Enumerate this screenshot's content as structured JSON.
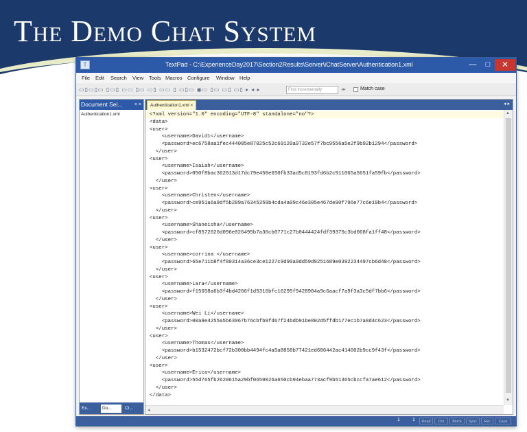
{
  "slide": {
    "title": "The Demo Chat System"
  },
  "window": {
    "title": "TextPad - C:\\ExperienceDay2017\\Section2Results\\Server\\iChatServer\\Authentication1.xml",
    "controls": {
      "minimize": "—",
      "maximize": "□",
      "close": "✕"
    }
  },
  "menu": [
    "File",
    "Edit",
    "Search",
    "View",
    "Tools",
    "Macros",
    "Configure",
    "Window",
    "Help"
  ],
  "toolbar": {
    "find_placeholder": "Find Incrementally",
    "match_case_label": "Match case"
  },
  "document_selector": {
    "title": "Document Sel...",
    "close": "× ×",
    "files": [
      "Authentication1.xml"
    ],
    "tabs": [
      "Ex...",
      "Do...",
      "Cl..."
    ]
  },
  "editor": {
    "tab_label": "Authentication1.xml ×",
    "tabstrip_controls": "◂ ▸",
    "lines": [
      "<?xml version=\"1.0\" encoding=\"UTF-8\" standalone=\"no\"?>",
      "<data>",
      "<user>",
      "    <username>David1</username>",
      "    <password>ec6758aa1fec444085e87025c52c69120a9732e57f7bc9556a5e2f9b92b1294</password>",
      "  </user>",
      "<user>",
      "    <username>Isaiah</username>",
      "    <password>050f8bac362013d17dc79e450e650fb33ad5c8193fd6b2c911065a5651fa59fb</password>",
      "  </user>",
      "<user>",
      "    <username>Christen</username>",
      "    <password>ce951a6a9df5b289a76345359b4cda4a09c46e305e467de90f796e77c6e19b4</password>",
      "  </user>",
      "<user>",
      "    <username>Shaneisha</username>",
      "    <password>cf8572026d096e026495b7a36cb0771c27b0444424fdf39375c3bd068fa1ff48</password>",
      "  </user>",
      "<user>",
      "    <username>corrina </username>",
      "    <password>65e711b8f4f80314a36ce3ce1227c9d90a9dd59d9251689e0392234497cb6d48</password>",
      "  </user>",
      "<user>",
      "    <username>Lara</username>",
      "    <password>f15658a6b3f4bd4266f1d5316bfc16295f9428904a9c6aacf7a9f3a3c5df7bb6</password>",
      "  </user>",
      "<user>",
      "    <username>Wei Li</username>",
      "    <password>00a9e4255a5b63067b76cbfb9fd67f24bdb91be802d5ffdb177ec1b7a8d4c623</password>",
      "  </user>",
      "<user>",
      "    <username>Thomas</username>",
      "    <password>b1532472bcf72b300bb4494fc4a5a8858b77421ed606442ac414002b9cc9f43f</password>",
      "  </user>",
      "<user>",
      "    <username>Erica</username>",
      "    <password>55d765fb2620615a29bf0650026a650cb94ebaa773acf9b51365cbccfa7ae612</password>",
      "  </user>",
      "</data>"
    ]
  },
  "statusbar": {
    "line": "1",
    "col": "1",
    "cells": [
      "Read",
      "Ovr",
      "Block",
      "Sync",
      "Rec",
      "Caps"
    ]
  }
}
